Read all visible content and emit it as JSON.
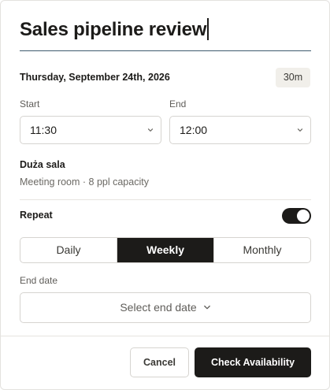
{
  "event": {
    "title": "Sales pipeline review",
    "date": "Thursday, September 24th, 2026",
    "duration": "30m"
  },
  "time": {
    "start_label": "Start",
    "start_value": "11:30",
    "end_label": "End",
    "end_value": "12:00"
  },
  "room": {
    "name": "Duża sala",
    "description": "Meeting room · 8 ppl capacity"
  },
  "repeat": {
    "label": "Repeat",
    "enabled": true,
    "options": [
      "Daily",
      "Weekly",
      "Monthly"
    ],
    "selected": "Weekly"
  },
  "end_date": {
    "label": "End date",
    "placeholder": "Select end date"
  },
  "footer": {
    "cancel_label": "Cancel",
    "primary_label": "Check Availability"
  }
}
